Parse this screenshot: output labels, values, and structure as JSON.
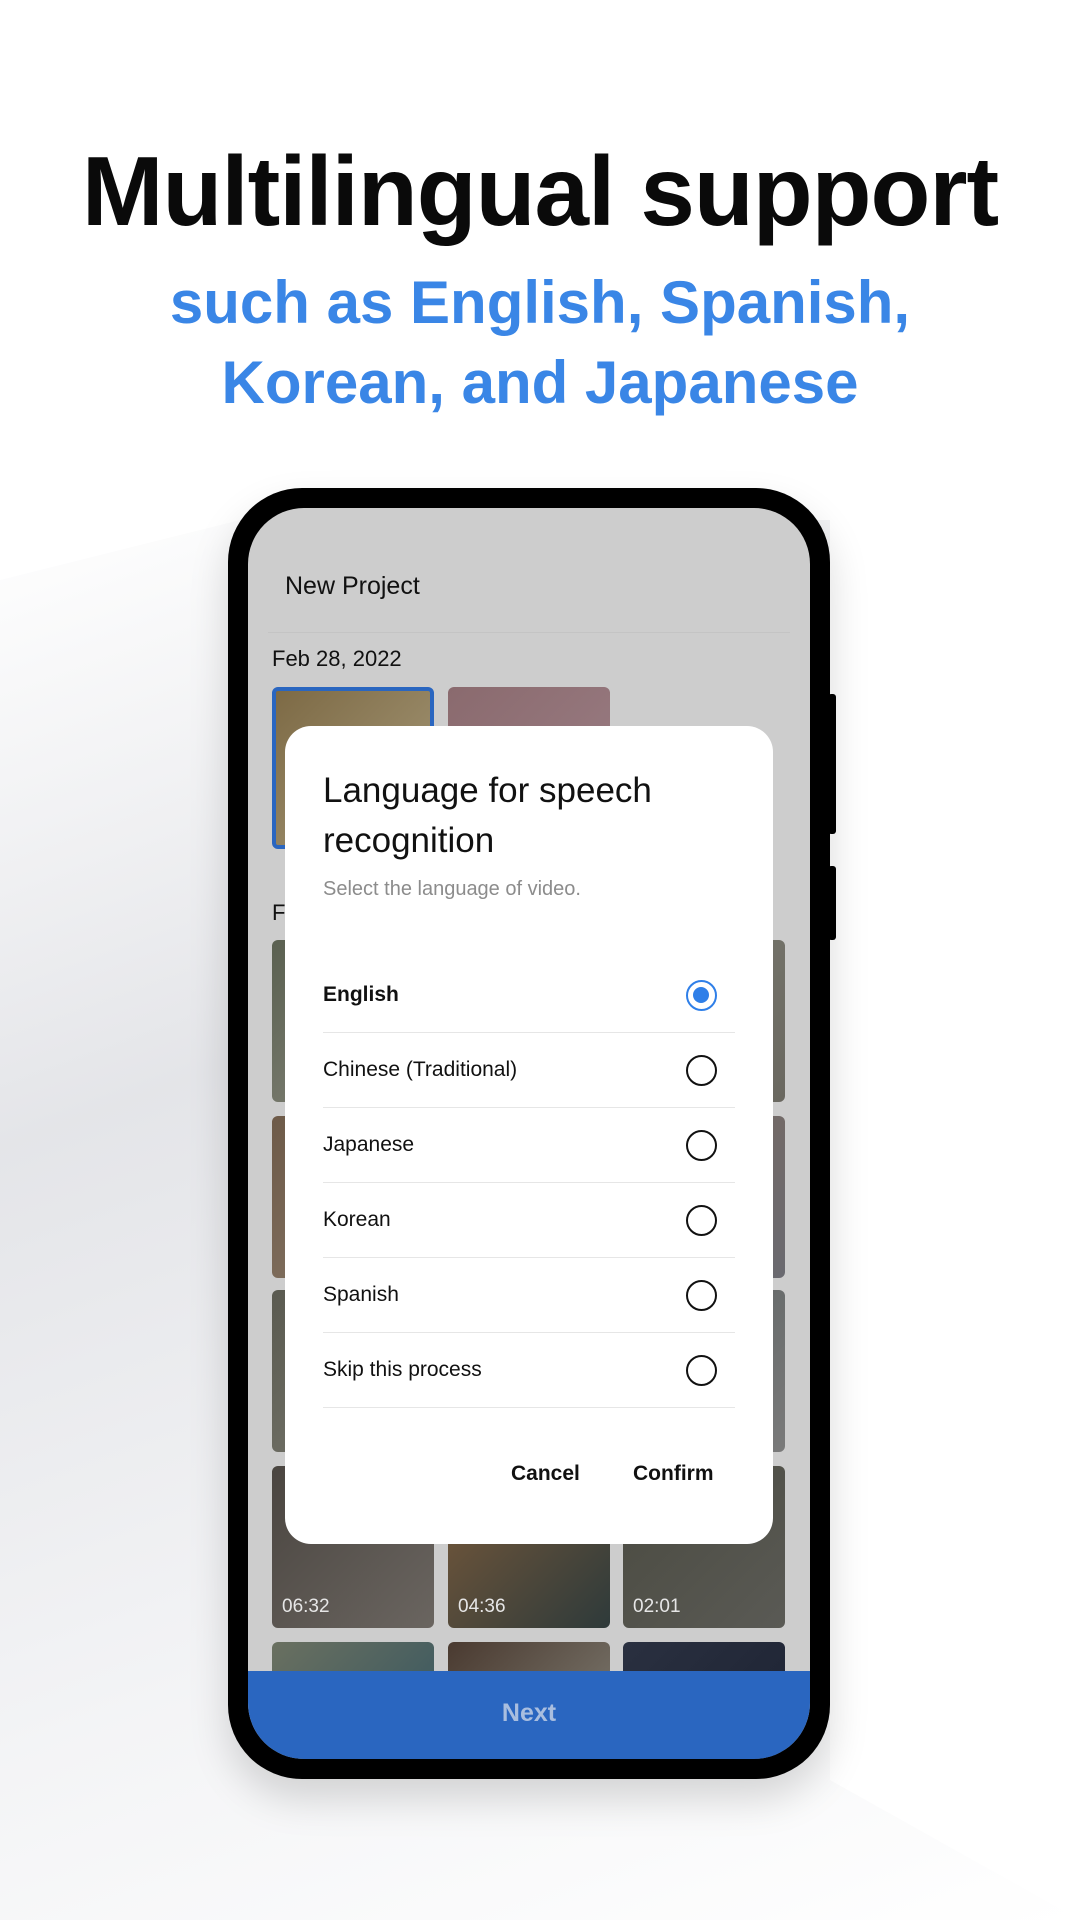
{
  "headline": "Multilingual support",
  "subheadline": [
    "such as English, Spanish,",
    "Korean, and Japanese"
  ],
  "app": {
    "header_title": "New Project",
    "section_date": "Feb 28, 2022",
    "section2_label_partial": "F",
    "thumb_durations": [
      "06:32",
      "04:36",
      "02:01"
    ],
    "next_label": "Next"
  },
  "dialog": {
    "title": "Language for speech recognition",
    "subtitle": "Select the language of video.",
    "options": [
      {
        "label": "English",
        "selected": true
      },
      {
        "label": "Chinese (Traditional)",
        "selected": false
      },
      {
        "label": "Japanese",
        "selected": false
      },
      {
        "label": "Korean",
        "selected": false
      },
      {
        "label": "Spanish",
        "selected": false
      },
      {
        "label": "Skip this process",
        "selected": false
      }
    ],
    "cancel_label": "Cancel",
    "confirm_label": "Confirm"
  },
  "colors": {
    "accent": "#2f7fe8",
    "subheadline": "#3a86e6",
    "next_bar": "#2a66c0"
  }
}
